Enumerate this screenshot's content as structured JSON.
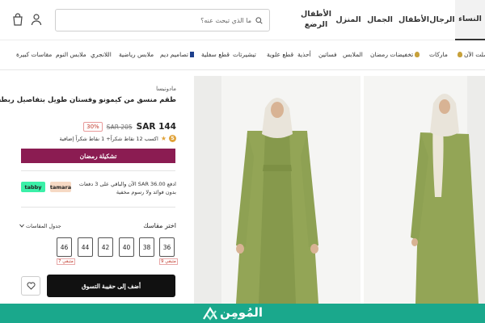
{
  "header": {
    "search_placeholder": "ما الذي تبحث عنه؟",
    "nav": [
      {
        "label": "النساء"
      },
      {
        "label": "الرجال"
      },
      {
        "label": "الأطفال"
      },
      {
        "label": "الجمال"
      },
      {
        "label": "المنزل"
      },
      {
        "label": "الأطفال الرضع"
      }
    ]
  },
  "subnav": {
    "items": [
      {
        "label": "وصلت الآن"
      },
      {
        "label": "ماركات"
      },
      {
        "label": "تخفيضات رمضان"
      },
      {
        "label": "الملابس"
      },
      {
        "label": "فساتين"
      },
      {
        "label": "أحذية"
      },
      {
        "label": "قطع علوية"
      },
      {
        "label": "تيشيرتات"
      },
      {
        "label": "قطع سفلية"
      },
      {
        "label": "تصاميم ديم"
      },
      {
        "label": "ملابس رياضية"
      },
      {
        "label": "اللانجري"
      },
      {
        "label": "ملابس النوم"
      },
      {
        "label": "مقاسات كبيرة"
      }
    ]
  },
  "product": {
    "brand": "مادونيسا",
    "title": "طقم منسق من كيمونو وفستان طويل بتفاصيل ربطة",
    "price": "SAR 144",
    "old_price": "SAR 205",
    "discount": "30%",
    "points_text": "اكسب 12 نقاط شكراً+ 1 نقاط شكراً إضافية",
    "coin_symbol": "S",
    "collection_button": "تشكيلة رمضان",
    "installment_text": "ادفع SAR 36.00 الآن والباقي على 3 دفعات بدون فوائد ولا رسوم مخفية",
    "pay_tabby": "tabby",
    "pay_tamara": "tamara",
    "size_title": "اختر مقاسك",
    "size_guide": "جدول المقاسات",
    "sizes": [
      "36",
      "38",
      "40",
      "42",
      "44",
      "46"
    ],
    "stock_36": "9 متبقي",
    "stock_46": "7 متبقي",
    "add_to_bag": "أضف إلى حقيبة التسوق"
  },
  "banner": {
    "text": "المُومِن"
  },
  "colors": {
    "collection_button": "#8b1c52",
    "banner": "#1aa88c",
    "add_button": "#111111",
    "garment": "#93a556"
  }
}
